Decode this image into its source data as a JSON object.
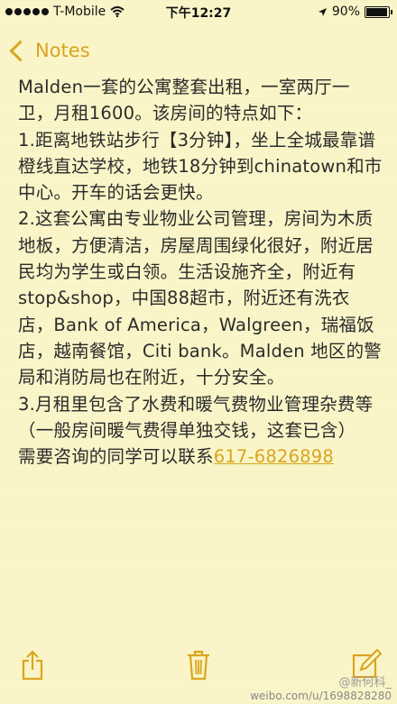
{
  "status": {
    "carrier": "T-Mobile",
    "time": "下午12:27",
    "battery": "90%"
  },
  "nav": {
    "back_label": "Notes"
  },
  "note": {
    "lines": [
      "Malden一套的公寓整套出租，一室两厅一卫，月租1600。该房间的特点如下：",
      "1.距离地铁站步行【3分钟】，坐上全城最靠谱橙线直达学校，地铁18分钟到chinatown和市中心。开车的话会更快。",
      "2.这套公寓由专业物业公司管理，房间为木质地板，方便清洁，房屋周围绿化很好，附近居民均为学生或白领。生活设施齐全，附近有stop&shop，中国88超市，附近还有洗衣店，Bank of America，Walgreen，瑞福饭店，越南餐馆，Citi bank。Malden 地区的警局和消防局也在附近，十分安全。",
      "3.月租里包含了水费和暖气费物业管理杂费等（一般房间暖气费得单独交钱，这套已含）"
    ],
    "contact_prefix": "需要咨询的同学可以联系",
    "phone": "617-6826898"
  },
  "watermark": {
    "name": "@新何科_",
    "url": "weibo.com/u/1698828280"
  },
  "colors": {
    "accent": "#d9a520",
    "paper": "#fbf6c9"
  }
}
